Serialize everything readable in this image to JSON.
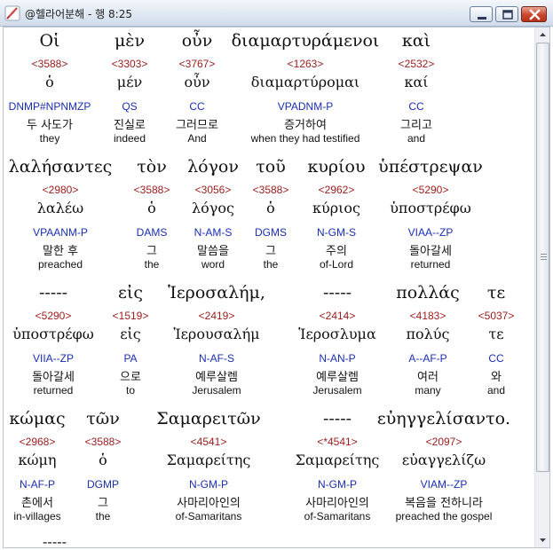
{
  "window": {
    "title": "@헬라어분해 - 행 8:25",
    "title_icon": "app-feather-icon",
    "controls": [
      "minimize-icon",
      "maximize-icon",
      "close-icon"
    ]
  },
  "colors": {
    "strong_number": "#9b1b1b",
    "parse_code": "#1a2fb0",
    "text": "#111111"
  },
  "lines": [
    [
      {
        "greek": "Οἱ",
        "strong": "<3588>",
        "lemma": "ὁ",
        "parse": "DNMP#NPNMZP",
        "korean": "두 사도가",
        "english": "they"
      },
      {
        "greek": "μὲν",
        "strong": "<3303>",
        "lemma": "μέν",
        "parse": "QS",
        "korean": "진실로",
        "english": "indeed"
      },
      {
        "greek": "οὖν",
        "strong": "<3767>",
        "lemma": "οὖν",
        "parse": "CC",
        "korean": "그러므로",
        "english": "And"
      },
      {
        "greek": "διαμαρτυράμενοι",
        "strong": "<1263>",
        "lemma": "διαμαρτύρομαι",
        "parse": "VPADNM-P",
        "korean": "증거하여",
        "english": "when they had testified"
      },
      {
        "greek": "καὶ",
        "strong": "<2532>",
        "lemma": "καί",
        "parse": "CC",
        "korean": "그리고",
        "english": "and"
      }
    ],
    [
      {
        "greek": "λαλήσαντες",
        "strong": "<2980>",
        "lemma": "λαλέω",
        "parse": "VPAANM-P",
        "korean": "말한 후",
        "english": "preached"
      },
      {
        "greek": "τὸν",
        "strong": "<3588>",
        "lemma": "ὁ",
        "parse": "DAMS",
        "korean": "그",
        "english": "the"
      },
      {
        "greek": "λόγον",
        "strong": "<3056>",
        "lemma": "λόγος",
        "parse": "N-AM-S",
        "korean": "말씀을",
        "english": "word"
      },
      {
        "greek": "τοῦ",
        "strong": "<3588>",
        "lemma": "ὁ",
        "parse": "DGMS",
        "korean": "그",
        "english": "the"
      },
      {
        "greek": "κυρίου",
        "strong": "<2962>",
        "lemma": "κύριος",
        "parse": "N-GM-S",
        "korean": "주의",
        "english": "of-Lord"
      },
      {
        "greek": "ὑπέστρεψαν",
        "strong": "<5290>",
        "lemma": "ὑποστρέφω",
        "parse": "VIAA--ZP",
        "korean": "돌아갈세",
        "english": "returned"
      }
    ],
    [
      {
        "greek": "-----",
        "strong": "<5290>",
        "lemma": "ὑποστρέφω",
        "parse": "VIIA--ZP",
        "korean": "돌아갈세",
        "english": "returned"
      },
      {
        "greek": "εἰς",
        "strong": "<1519>",
        "lemma": "εἰς",
        "parse": "PA",
        "korean": "으로",
        "english": "to"
      },
      {
        "greek": "Ἱεροσαλήμ,",
        "strong": "<2419>",
        "lemma": "Ἱερουσαλήμ",
        "parse": "N-AF-S",
        "korean": "예루살렘",
        "english": "Jerusalem"
      },
      {
        "greek": "-----",
        "strong": "<2414>",
        "lemma": "Ἱεροσλυμα",
        "parse": "N-AN-P",
        "korean": "예루살렘",
        "english": "Jerusalem"
      },
      {
        "greek": "πολλάς",
        "strong": "<4183>",
        "lemma": "πολύς",
        "parse": "A--AF-P",
        "korean": "여러",
        "english": "many"
      },
      {
        "greek": "τε",
        "strong": "<5037>",
        "lemma": "τε",
        "parse": "CC",
        "korean": "와",
        "english": "and"
      }
    ],
    [
      {
        "greek": "κώμας",
        "strong": "<2968>",
        "lemma": "κώμη",
        "parse": "N-AF-P",
        "korean": "촌에서",
        "english": "in-villages"
      },
      {
        "greek": "τῶν",
        "strong": "<3588>",
        "lemma": "ὁ",
        "parse": "DGMP",
        "korean": "그",
        "english": "the"
      },
      {
        "greek": "Σαμαρειτῶν",
        "strong": "<4541>",
        "lemma": "Σαμαρείτης",
        "parse": "N-GM-P",
        "korean": "사마리아인의",
        "english": "of-Samaritans"
      },
      {
        "greek": "-----",
        "strong": "<*4541>",
        "lemma": "Σαμαρείτης",
        "parse": "N-GM-P",
        "korean": "사마리아인의",
        "english": "of-Samaritans"
      },
      {
        "greek": "εὐηγγελίσαντο.",
        "strong": "<2097>",
        "lemma": "εὐαγγελίζω",
        "parse": "VIAM--ZP",
        "korean": "복음을 전하니라",
        "english": "preached the gospel"
      }
    ]
  ],
  "trailing_greek": "-----"
}
